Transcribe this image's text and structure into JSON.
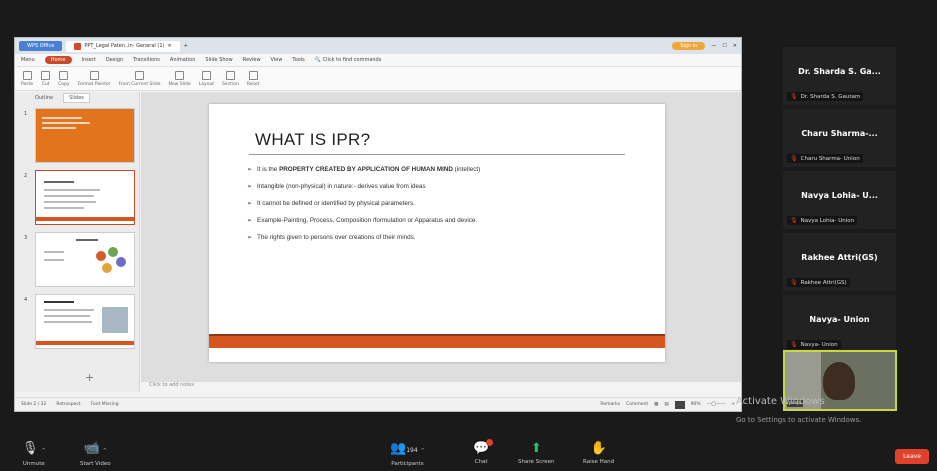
{
  "window": {
    "office_tab": "WPS Office",
    "doc_tab": "PPT_Legal Paten..in- General (1)",
    "sign_in": "Sign in"
  },
  "menu": [
    "Menu",
    "Home",
    "Insert",
    "Design",
    "Transitions",
    "Animation",
    "Slide Show",
    "Review",
    "View",
    "Tools"
  ],
  "menu_search": "Click to find commands",
  "ribbon": [
    "Paste",
    "Cut",
    "Copy",
    "Format Painter",
    "From Current Slide",
    "New Slide",
    "Layout",
    "Section",
    "Reset"
  ],
  "left_pane": {
    "tab_outline": "Outline",
    "tab_slides": "Slides",
    "thumbs": [
      "1",
      "2",
      "3",
      "4"
    ],
    "add": "+"
  },
  "slide": {
    "title": "WHAT IS IPR?",
    "b1_pre": "It is the ",
    "b1_bold": "PROPERTY CREATED BY APPLICATION OF HUMAN MIND",
    "b1_post": " (intellect)",
    "b2": "Intangible (non-physical) in nature:- derives value from ideas",
    "b3": "It cannot be defined or identified by physical parameters.",
    "b4": "Example-Painting, Process, Composition /formulation or Apparatus and device.",
    "b5": "The rights given to persons over creations of their minds."
  },
  "notes": "Click to add notes",
  "status": {
    "slide": "Slide 2 / 32",
    "theme": "Retrospect",
    "font": "Font Missing",
    "remarks": "Remarks",
    "comment": "Comment",
    "zoom": "90%"
  },
  "participants": [
    {
      "name": "Dr. Sharda S. Ga...",
      "sub": "Dr. Sharda S. Gautam"
    },
    {
      "name": "Charu Sharma-...",
      "sub": "Charu Sharma- Union"
    },
    {
      "name": "Navya Lohia- U...",
      "sub": "Navya Lohia- Union"
    },
    {
      "name": "Rakhee Attri(GS)",
      "sub": "Rakhee Attri(GS)"
    },
    {
      "name": "Navya- Union",
      "sub": "Navya- Union"
    }
  ],
  "video_label": "pooja",
  "watermark": {
    "line1": "Activate Windows",
    "line2": "Go to Settings to activate Windows."
  },
  "toolbar": {
    "unmute": "Unmute",
    "start_video": "Start Video",
    "participants": "Participants",
    "participants_count": "194",
    "chat": "Chat",
    "share_screen": "Share Screen",
    "raise_hand": "Raise Hand",
    "leave": "Leave"
  },
  "colors": {
    "accent": "#d6561f",
    "leave": "#e0412b",
    "share": "#23c55e"
  }
}
